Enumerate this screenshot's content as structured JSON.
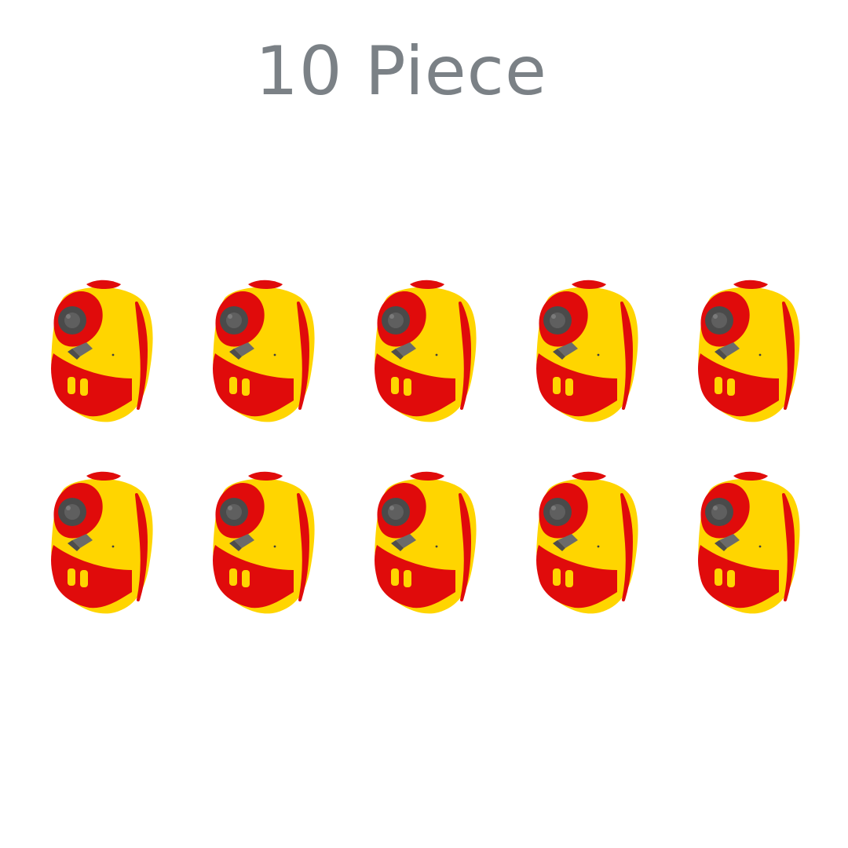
{
  "title": "10 Piece",
  "product": {
    "icon": "kids-camera-icon",
    "colors": {
      "body": "#ffd500",
      "accent": "#e00b0b",
      "lens": "#4a4a4a"
    }
  },
  "quantity": 10
}
